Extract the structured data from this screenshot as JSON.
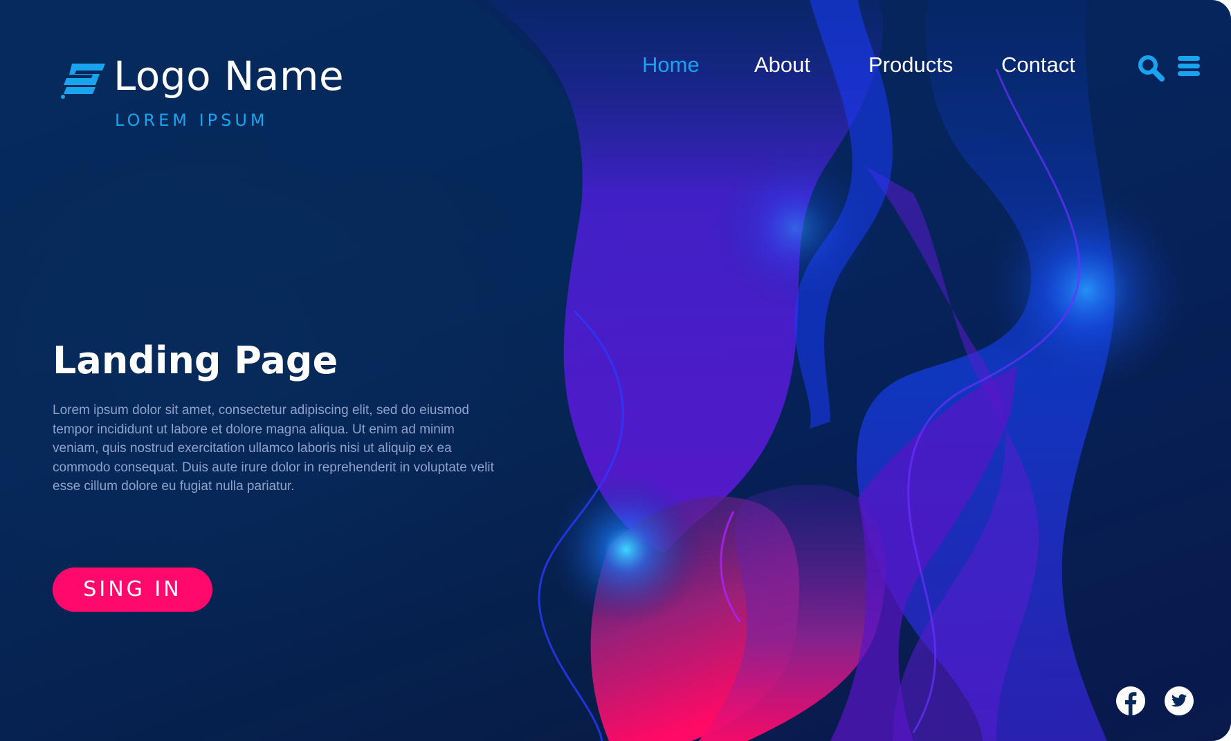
{
  "brand": {
    "name": "Logo Name",
    "tagline": "LOREM IPSUM",
    "logo_icon": "logo-mark-icon"
  },
  "nav": {
    "items": [
      {
        "label": "Home",
        "active": true
      },
      {
        "label": "About",
        "active": false
      },
      {
        "label": "Products",
        "active": false
      },
      {
        "label": "Contact",
        "active": false
      }
    ],
    "search_icon": "search-icon",
    "menu_icon": "hamburger-menu-icon"
  },
  "hero": {
    "title": "Landing Page",
    "body": "Lorem ipsum dolor sit amet, consectetur adipiscing elit, sed do eiusmod tempor incididunt ut labore et dolore magna aliqua. Ut enim ad minim veniam, quis nostrud exercitation ullamco laboris nisi ut aliquip ex ea commodo consequat. Duis aute irure dolor in reprehenderit in voluptate velit esse cillum dolore eu fugiat nulla pariatur.",
    "cta_label": "SING IN"
  },
  "social": {
    "facebook_icon": "facebook-icon",
    "twitter_icon": "twitter-icon"
  },
  "colors": {
    "background": "#05285a",
    "accent": "#1aa3ee",
    "cta": "#ff0a6c",
    "body_text": "#8fa2cc",
    "heading": "#ffffff"
  }
}
